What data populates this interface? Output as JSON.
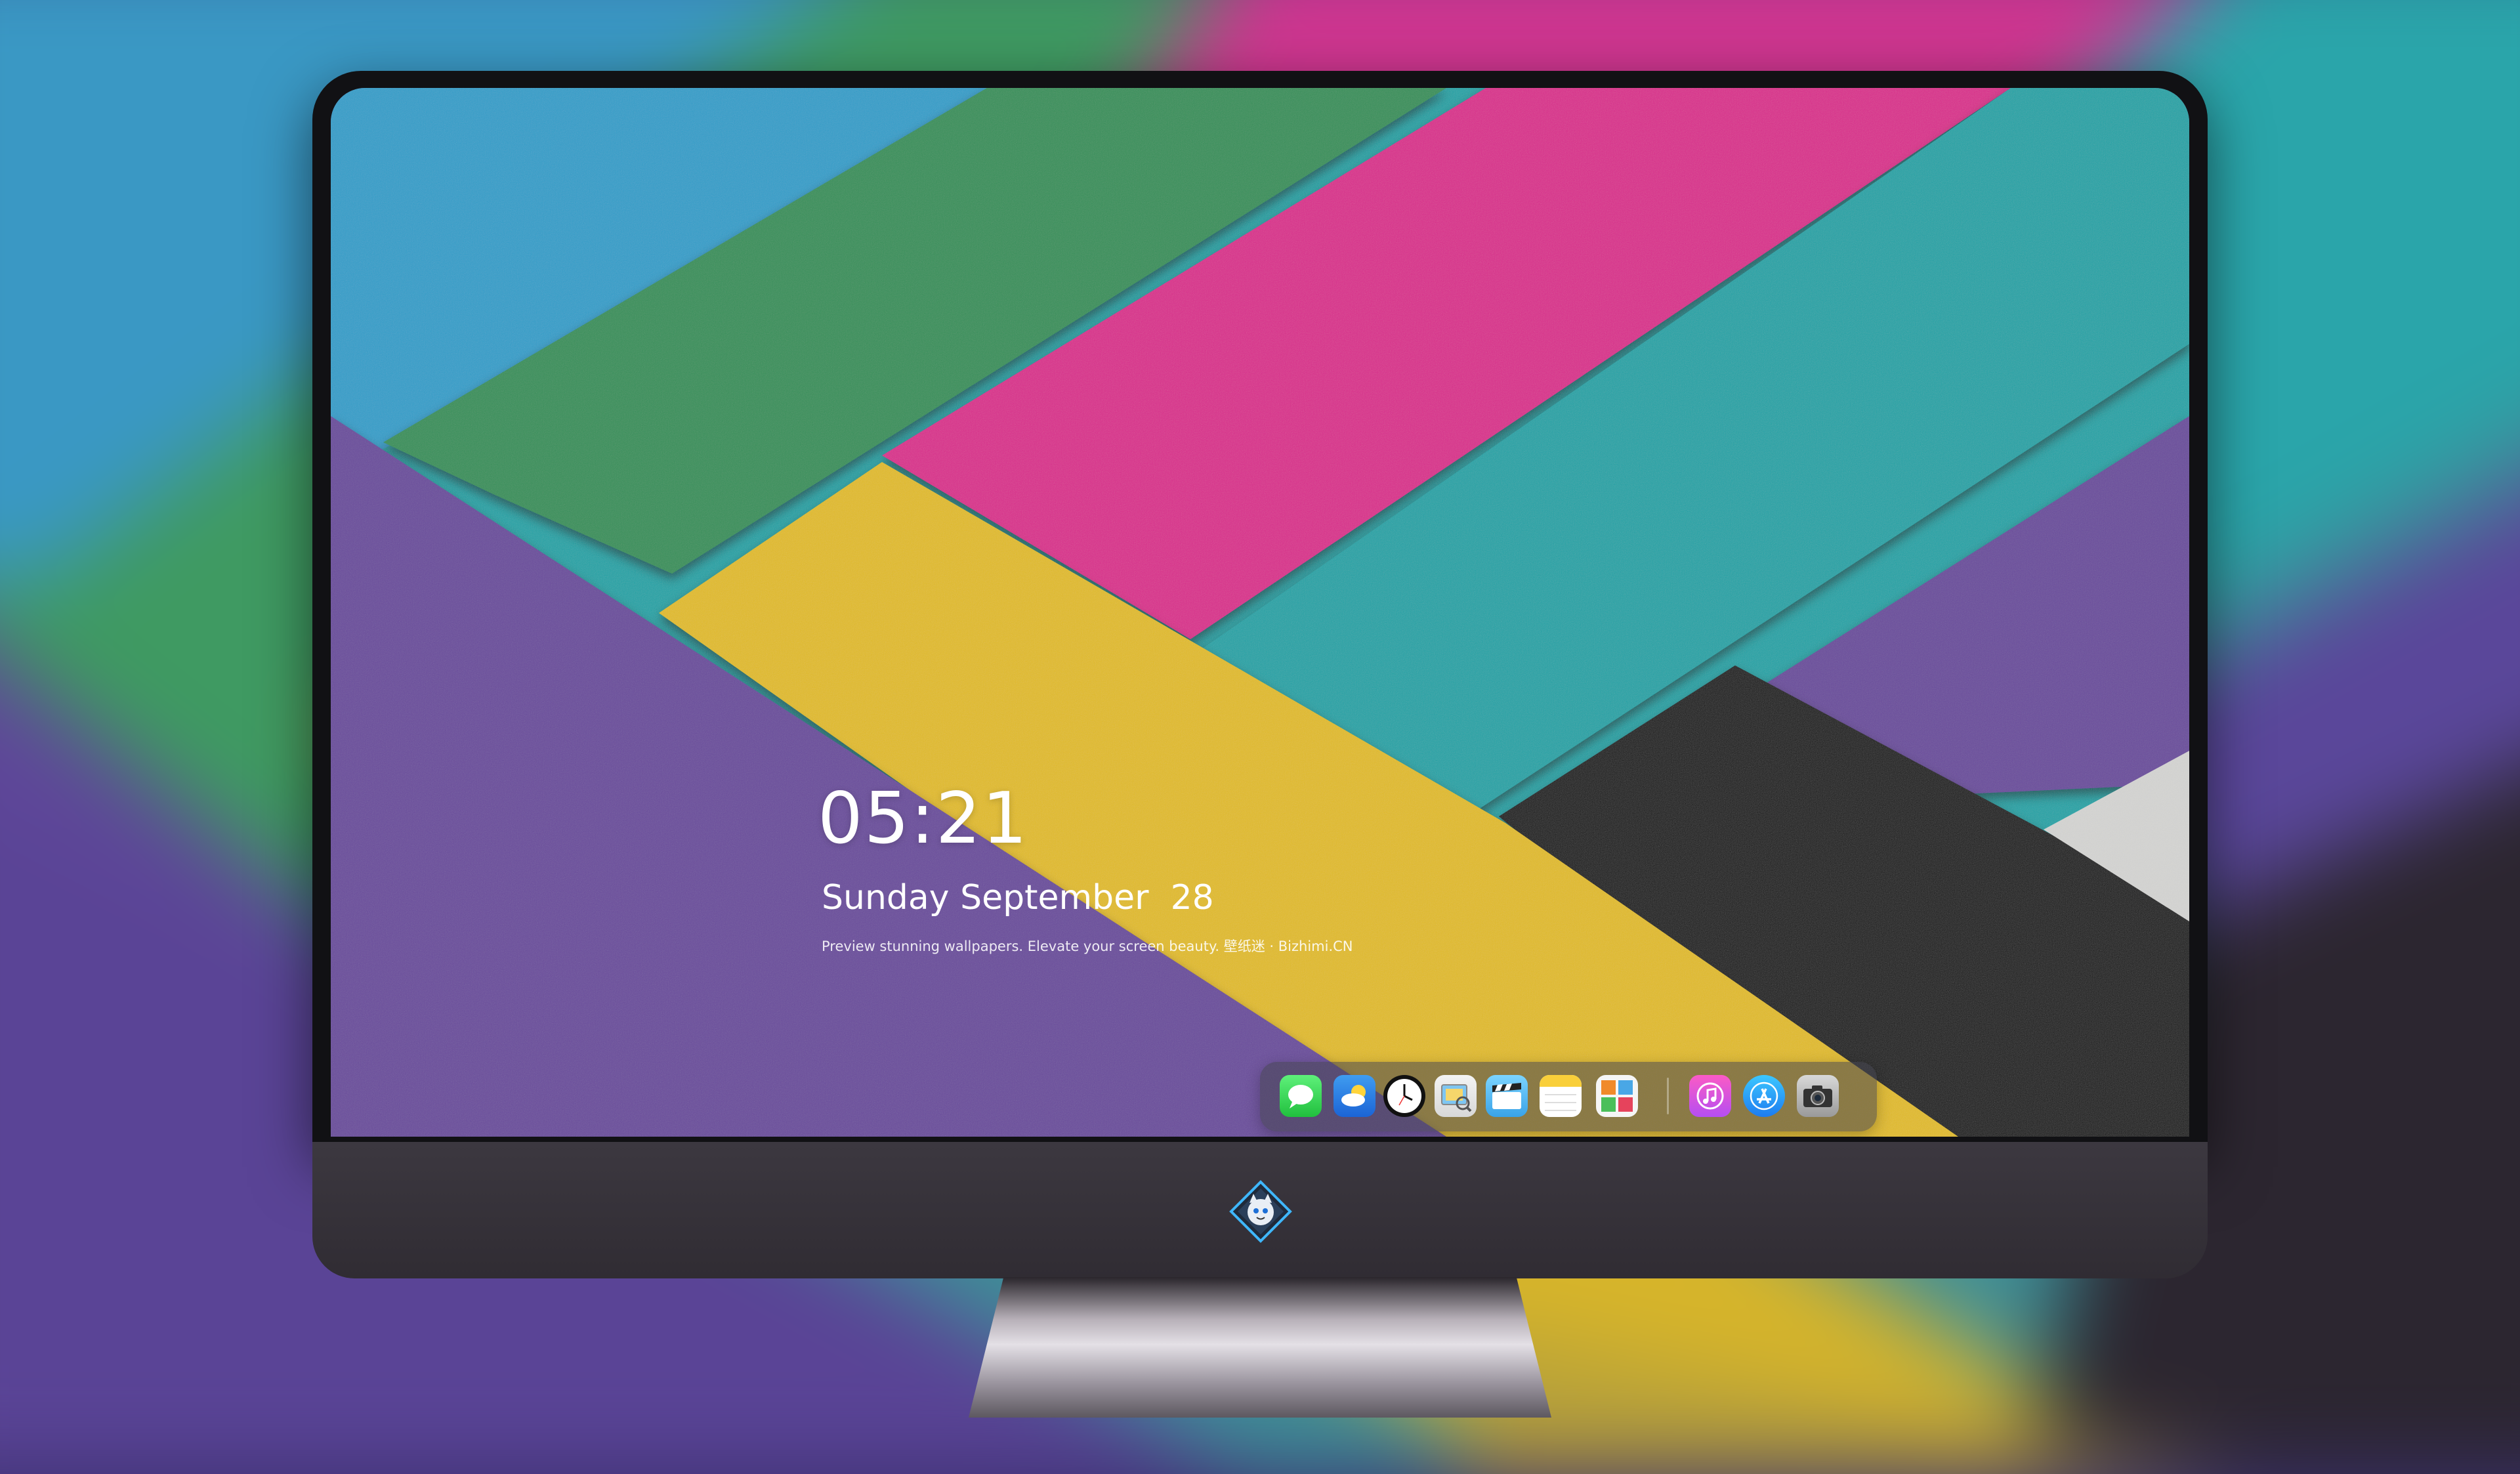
{
  "lockscreen": {
    "time": "05:21",
    "date": "Sunday September  28",
    "tagline": "Preview stunning wallpapers. Elevate your screen beauty. 壁纸迷 · Bizhimi.CN"
  },
  "dock": {
    "apps": [
      {
        "name": "messages-icon"
      },
      {
        "name": "weather-icon"
      },
      {
        "name": "clock-icon"
      },
      {
        "name": "preview-icon"
      },
      {
        "name": "clips-icon"
      },
      {
        "name": "notes-icon"
      },
      {
        "name": "photo-booth-icon"
      },
      {
        "name": "music-icon"
      },
      {
        "name": "app-store-icon"
      },
      {
        "name": "camera-icon"
      }
    ]
  },
  "wallpaper_colors": {
    "blue": "#2f9ec9",
    "green": "#34905a",
    "magenta": "#d92c8c",
    "teal": "#1aa3a6",
    "purple": "#6a4c9c",
    "yellow": "#e1bb24",
    "black": "#141416",
    "white": "#d4d4d2"
  },
  "monitor": {
    "chin_logo": "chin-logo-icon"
  }
}
